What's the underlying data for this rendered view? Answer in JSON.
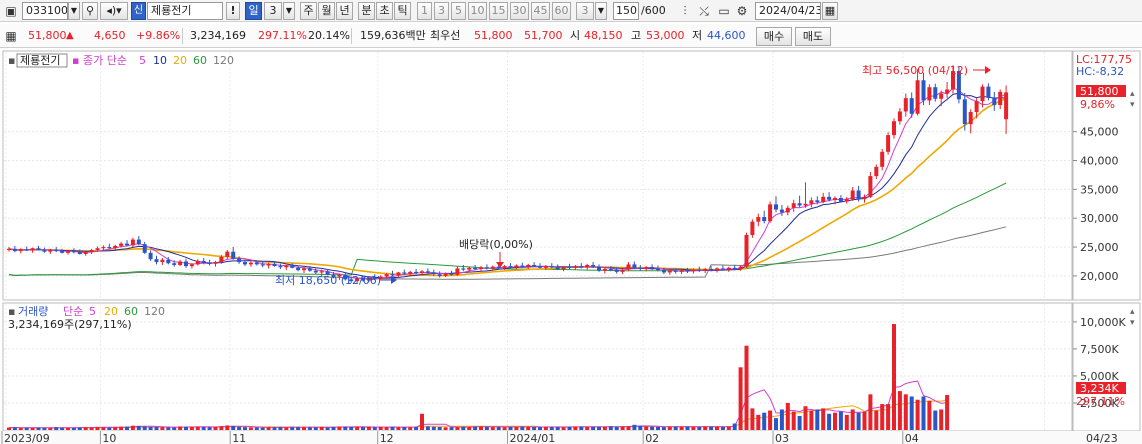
{
  "toolbar": {
    "code": "033100",
    "badge": "신",
    "name": "제룡전기",
    "exclaim": "!",
    "period_active": "일",
    "period_num": "3",
    "periods": [
      "주",
      "월",
      "년",
      "분",
      "초",
      "틱"
    ],
    "intervals": [
      "1",
      "3",
      "5",
      "10",
      "15",
      "30",
      "45",
      "60"
    ],
    "interval_sel": "3",
    "count_cur": "150",
    "count_total": "/600",
    "date": "2024/04/23",
    "icons": [
      "window-icon",
      "dropdown-icon",
      "search-icon",
      "volume-icon",
      "candle-icon",
      "crosshair-icon",
      "save-icon",
      "settings-icon",
      "calendar-icon"
    ]
  },
  "quote": {
    "price": "51,800",
    "up_arrow": "▲",
    "change": "4,650",
    "change_pct": "+9.86%",
    "volume": "3,234,169",
    "vol_ratio": "297.11%",
    "turnover": "20.14%",
    "amount": "159,636백만",
    "best_label": "최우선",
    "best_ask": "51,800",
    "best_bid": "51,700",
    "open_label": "시",
    "open": "48,150",
    "high_label": "고",
    "high": "53,000",
    "low_label": "저",
    "low": "44,600",
    "buy_label": "매수",
    "sell_label": "매도"
  },
  "price_legend": {
    "name": "제룡전기",
    "ma_label": "종가 단순",
    "ma_periods": [
      "5",
      "10",
      "20",
      "60",
      "120"
    ]
  },
  "volume_legend": {
    "name": "거래량",
    "ma_label": "단순",
    "ma_periods": [
      "5",
      "20",
      "60",
      "120"
    ],
    "current": "3,234,169주(297,11%)"
  },
  "annotations": {
    "high": "최고 56,500 (04/12)",
    "low": "최저 18,650 (12/06)",
    "dividend": "배당락(0,00%)"
  },
  "right_panel": {
    "lc": "LC:177,75",
    "hc": "HC:-8,32",
    "price_tag": "51,800",
    "pct_tag": "9,86%",
    "vol_tag": "3,234K",
    "vol_pct_tag": "297,11%"
  },
  "colors": {
    "up": "#e8222a",
    "down": "#2a56c8",
    "ma5": "#d040d0",
    "ma10": "#1f2d9a",
    "ma20": "#f0a800",
    "ma60": "#2a9a3c",
    "ma120": "#7a7a7a"
  },
  "chart_data": {
    "type": "candlestick",
    "price_axis": {
      "ticks": [
        "45,000",
        "40,000",
        "35,000",
        "30,000",
        "25,000",
        "20,000"
      ],
      "tick_values": [
        45000,
        40000,
        35000,
        30000,
        25000,
        20000
      ],
      "ylim": [
        16000,
        58800
      ]
    },
    "volume_axis": {
      "ticks": [
        "10,000K",
        "7,500K",
        "5,000K",
        "2,500K"
      ],
      "tick_values": [
        10000,
        7500,
        5000,
        2500
      ],
      "ylim": [
        0,
        11100
      ]
    },
    "x_labels": [
      "2023/09",
      "10",
      "11",
      "12",
      "2024/01",
      "02",
      "03",
      "04",
      "04/23"
    ],
    "x_label_indices": [
      0,
      16,
      38,
      63,
      85,
      108,
      130,
      152,
      176
    ],
    "candles": [
      [
        24500,
        25000,
        24200,
        24700
      ],
      [
        24700,
        25200,
        24100,
        24300
      ],
      [
        24300,
        24800,
        23900,
        24600
      ],
      [
        24600,
        25100,
        24300,
        24400
      ],
      [
        24400,
        24900,
        24000,
        24800
      ],
      [
        24800,
        25200,
        24400,
        24500
      ],
      [
        24500,
        24900,
        24000,
        24200
      ],
      [
        24200,
        24700,
        23800,
        24500
      ],
      [
        24500,
        25000,
        24100,
        24300
      ],
      [
        24300,
        24700,
        23900,
        24000
      ],
      [
        24000,
        24500,
        23700,
        24300
      ],
      [
        24300,
        24800,
        23900,
        24100
      ],
      [
        24100,
        24600,
        23700,
        23800
      ],
      [
        23800,
        24300,
        23500,
        24100
      ],
      [
        24100,
        24700,
        23800,
        24500
      ],
      [
        24500,
        25100,
        24200,
        24800
      ],
      [
        24800,
        25300,
        24400,
        25000
      ],
      [
        25000,
        25600,
        24700,
        24800
      ],
      [
        24800,
        25400,
        24500,
        25200
      ],
      [
        25200,
        25900,
        24900,
        25600
      ],
      [
        25600,
        26200,
        25100,
        25300
      ],
      [
        25300,
        26600,
        25000,
        26300
      ],
      [
        26300,
        26900,
        25300,
        25500
      ],
      [
        25500,
        25900,
        23800,
        24000
      ],
      [
        24000,
        24400,
        22600,
        22900
      ],
      [
        22900,
        23500,
        22000,
        22400
      ],
      [
        22400,
        23100,
        21900,
        22800
      ],
      [
        22800,
        23300,
        22000,
        22200
      ],
      [
        22200,
        22700,
        21600,
        21900
      ],
      [
        21900,
        22800,
        21700,
        22500
      ],
      [
        22500,
        23000,
        21400,
        21700
      ],
      [
        21700,
        22200,
        21300,
        22000
      ],
      [
        22000,
        22900,
        21800,
        22600
      ],
      [
        22600,
        23100,
        22000,
        22300
      ],
      [
        22300,
        22800,
        21800,
        22100
      ],
      [
        22100,
        22600,
        21600,
        22400
      ],
      [
        22400,
        23600,
        22100,
        23300
      ],
      [
        23300,
        24500,
        22900,
        24200
      ],
      [
        24200,
        25000,
        22800,
        23000
      ],
      [
        23000,
        23400,
        22100,
        22400
      ],
      [
        22400,
        22800,
        21700,
        22000
      ],
      [
        22000,
        22500,
        21600,
        22300
      ],
      [
        22300,
        22700,
        21800,
        22000
      ],
      [
        22000,
        22400,
        21500,
        21800
      ],
      [
        21800,
        22300,
        21300,
        22100
      ],
      [
        22100,
        22500,
        21600,
        21700
      ],
      [
        21700,
        22100,
        21200,
        21500
      ],
      [
        21500,
        21900,
        21000,
        21800
      ],
      [
        21800,
        22200,
        21300,
        21400
      ],
      [
        21400,
        21800,
        20800,
        21000
      ],
      [
        21000,
        21600,
        20500,
        21300
      ],
      [
        21300,
        21700,
        20700,
        20900
      ],
      [
        20900,
        21300,
        20300,
        20600
      ],
      [
        20600,
        21100,
        20000,
        20800
      ],
      [
        20800,
        21200,
        20100,
        20200
      ],
      [
        20200,
        20700,
        19600,
        19900
      ],
      [
        19900,
        20400,
        19300,
        20200
      ],
      [
        20200,
        20600,
        19200,
        19400
      ],
      [
        19400,
        19900,
        18800,
        19100
      ],
      [
        19100,
        19800,
        18650,
        19600
      ],
      [
        19600,
        20100,
        19000,
        19200
      ],
      [
        19200,
        19900,
        18900,
        19700
      ],
      [
        19700,
        20300,
        19300,
        19500
      ],
      [
        19500,
        20100,
        19200,
        19900
      ],
      [
        19900,
        20500,
        19600,
        20300
      ],
      [
        20300,
        20900,
        19900,
        20100
      ],
      [
        20100,
        20700,
        19800,
        20600
      ],
      [
        20600,
        21100,
        20200,
        20400
      ],
      [
        20400,
        20900,
        20000,
        20700
      ],
      [
        20700,
        21200,
        20300,
        20500
      ],
      [
        20500,
        21000,
        20100,
        20800
      ],
      [
        20800,
        21300,
        20400,
        20600
      ],
      [
        20600,
        21100,
        20000,
        20300
      ],
      [
        20300,
        20800,
        19700,
        20000
      ],
      [
        20000,
        20600,
        19800,
        20400
      ],
      [
        20400,
        20900,
        20000,
        20200
      ],
      [
        20200,
        21700,
        20000,
        21300
      ],
      [
        21300,
        21900,
        20800,
        21100
      ],
      [
        21100,
        21600,
        20600,
        21400
      ],
      [
        21400,
        21900,
        21000,
        21200
      ],
      [
        21200,
        21700,
        20800,
        21500
      ],
      [
        21500,
        22000,
        21100,
        21300
      ],
      [
        21300,
        21800,
        20900,
        21600
      ],
      [
        21600,
        22100,
        21200,
        21400
      ],
      [
        21400,
        21900,
        21000,
        21700
      ],
      [
        21700,
        22200,
        21300,
        21500
      ],
      [
        21500,
        22000,
        21100,
        21800
      ],
      [
        21800,
        22300,
        21400,
        21600
      ],
      [
        21600,
        22100,
        21200,
        21900
      ],
      [
        21900,
        22400,
        21500,
        21700
      ],
      [
        21700,
        22200,
        21300,
        21400
      ],
      [
        21400,
        21900,
        21000,
        21700
      ],
      [
        21700,
        22200,
        21300,
        21500
      ],
      [
        21500,
        22000,
        21000,
        21200
      ],
      [
        21200,
        21700,
        20800,
        21600
      ],
      [
        21600,
        22100,
        21200,
        21400
      ],
      [
        21400,
        21900,
        21000,
        21700
      ],
      [
        21700,
        22200,
        21300,
        21500
      ],
      [
        21500,
        22100,
        21100,
        21900
      ],
      [
        21900,
        22400,
        21400,
        21600
      ],
      [
        21600,
        22000,
        20700,
        20900
      ],
      [
        20900,
        21400,
        20400,
        21200
      ],
      [
        21200,
        21700,
        20800,
        21000
      ],
      [
        21000,
        21500,
        20400,
        20700
      ],
      [
        20700,
        21300,
        20300,
        21100
      ],
      [
        21100,
        22400,
        20800,
        22000
      ],
      [
        22000,
        22500,
        21200,
        21400
      ],
      [
        21400,
        21900,
        20900,
        21200
      ],
      [
        21200,
        21700,
        20800,
        21500
      ],
      [
        21500,
        22000,
        21000,
        21300
      ],
      [
        21300,
        21800,
        20800,
        21000
      ],
      [
        21000,
        21400,
        20300,
        20600
      ],
      [
        20600,
        21100,
        20200,
        20900
      ],
      [
        20900,
        21300,
        20400,
        20700
      ],
      [
        20700,
        21200,
        20300,
        21000
      ],
      [
        21000,
        21400,
        20500,
        20800
      ],
      [
        20800,
        21300,
        20400,
        21100
      ],
      [
        21100,
        21600,
        20700,
        20900
      ],
      [
        20900,
        21400,
        20500,
        21200
      ],
      [
        21200,
        21700,
        20800,
        21000
      ],
      [
        21000,
        21500,
        20600,
        21300
      ],
      [
        21300,
        21800,
        20900,
        21100
      ],
      [
        21100,
        21600,
        20700,
        21400
      ],
      [
        21400,
        21900,
        21000,
        21200
      ],
      [
        21200,
        21800,
        20900,
        21600
      ],
      [
        21600,
        27500,
        21400,
        27100
      ],
      [
        27100,
        29800,
        26600,
        29400
      ],
      [
        29400,
        30800,
        28600,
        30200
      ],
      [
        30200,
        31300,
        29100,
        29500
      ],
      [
        29500,
        32900,
        29200,
        32400
      ],
      [
        32400,
        33800,
        31000,
        31500
      ],
      [
        31500,
        32300,
        30400,
        31000
      ],
      [
        31000,
        32200,
        30500,
        31800
      ],
      [
        31800,
        33200,
        31100,
        32600
      ],
      [
        32600,
        33900,
        31900,
        32200
      ],
      [
        32200,
        36200,
        31800,
        32500
      ],
      [
        32500,
        33600,
        31900,
        33100
      ],
      [
        33100,
        33800,
        32400,
        32800
      ],
      [
        32800,
        34400,
        32600,
        33700
      ],
      [
        33700,
        34500,
        32900,
        33200
      ],
      [
        33200,
        33800,
        32400,
        33500
      ],
      [
        33500,
        34000,
        32700,
        32900
      ],
      [
        32900,
        33700,
        32500,
        33300
      ],
      [
        33300,
        35400,
        33000,
        34800
      ],
      [
        34800,
        35600,
        32900,
        33300
      ],
      [
        33300,
        34100,
        32700,
        33700
      ],
      [
        33700,
        38000,
        33500,
        37300
      ],
      [
        37300,
        39300,
        36800,
        38900
      ],
      [
        38900,
        42000,
        38300,
        41500
      ],
      [
        41500,
        44900,
        41000,
        44400
      ],
      [
        44400,
        47300,
        43800,
        46800
      ],
      [
        46800,
        49100,
        46200,
        48500
      ],
      [
        48500,
        51600,
        47600,
        50800
      ],
      [
        50800,
        51800,
        47400,
        48100
      ],
      [
        48100,
        55800,
        47800,
        53900
      ],
      [
        53900,
        55200,
        49600,
        50400
      ],
      [
        50400,
        53200,
        49600,
        52700
      ],
      [
        52700,
        53300,
        50200,
        50700
      ],
      [
        50700,
        52100,
        49400,
        51600
      ],
      [
        51600,
        53600,
        50800,
        52300
      ],
      [
        52300,
        56500,
        51600,
        55500
      ],
      [
        55500,
        56200,
        49900,
        50600
      ],
      [
        50600,
        51700,
        45200,
        46300
      ],
      [
        46300,
        48900,
        44700,
        48400
      ],
      [
        48400,
        50800,
        47300,
        50300
      ],
      [
        50300,
        53200,
        49200,
        52800
      ],
      [
        52800,
        53400,
        50400,
        50900
      ],
      [
        50900,
        51900,
        48600,
        49600
      ],
      [
        49600,
        52300,
        48900,
        51900
      ],
      [
        47150,
        53000,
        44600,
        51800
      ]
    ],
    "volume_k": [
      220,
      250,
      180,
      210,
      190,
      230,
      200,
      180,
      260,
      210,
      200,
      190,
      230,
      260,
      240,
      280,
      250,
      230,
      270,
      300,
      310,
      400,
      380,
      320,
      290,
      270,
      260,
      240,
      230,
      330,
      300,
      280,
      310,
      270,
      260,
      280,
      350,
      420,
      380,
      300,
      260,
      240,
      230,
      220,
      250,
      240,
      260,
      230,
      250,
      270,
      260,
      240,
      250,
      280,
      230,
      290,
      320,
      310,
      280,
      300,
      270,
      290,
      260,
      280,
      250,
      300,
      260,
      270,
      250,
      280,
      1500,
      330,
      300,
      280,
      250,
      260,
      270,
      300,
      280,
      310,
      340,
      290,
      270,
      280,
      260,
      300,
      280,
      310,
      290,
      270,
      260,
      280,
      270,
      290,
      260,
      300,
      320,
      310,
      280,
      300,
      290,
      280,
      350,
      310,
      330,
      350,
      480,
      400,
      320,
      300,
      280,
      270,
      290,
      320,
      300,
      310,
      290,
      280,
      330,
      310,
      300,
      280,
      310,
      600,
      5800,
      7800,
      2000,
      1400,
      1600,
      1800,
      1100,
      1900,
      2500,
      1700,
      1300,
      2200,
      1800,
      1900,
      2000,
      1500,
      1600,
      1700,
      1400,
      1900,
      1600,
      1700,
      3300,
      1800,
      2400,
      2400,
      9800,
      3600,
      3300,
      3100,
      2800,
      3100,
      2700,
      1800,
      1900,
      3234
    ],
    "ma_windows": {
      "ma5": 5,
      "ma10": 10,
      "ma20": 20,
      "ma60": 60,
      "ma120": 120
    }
  }
}
